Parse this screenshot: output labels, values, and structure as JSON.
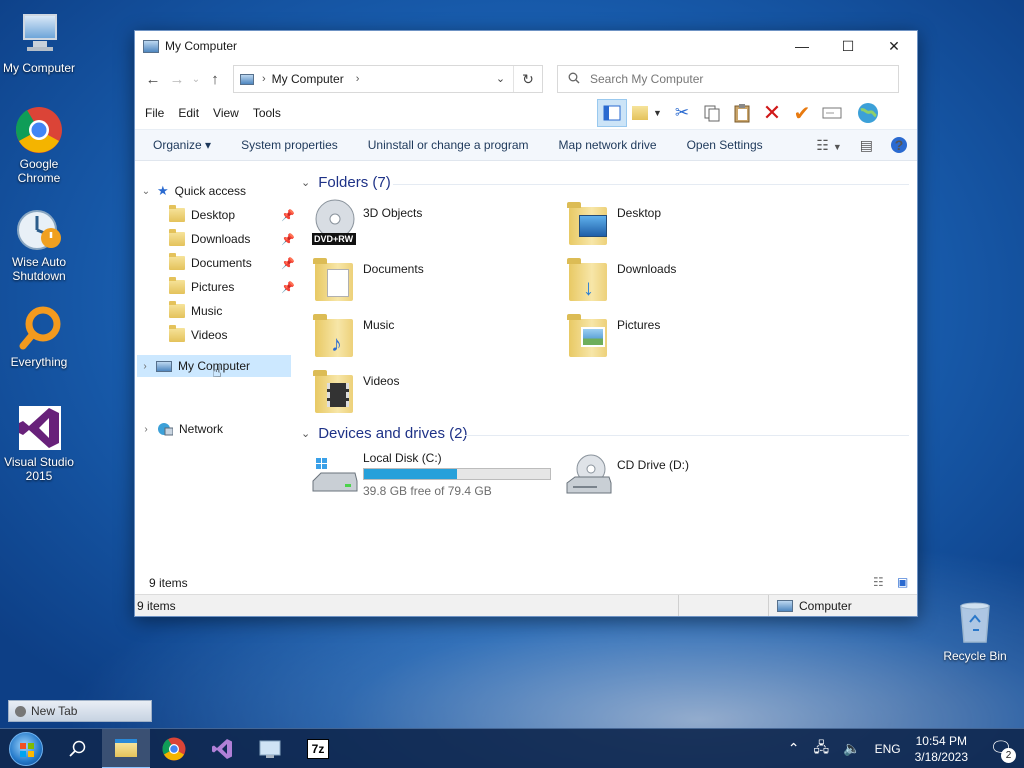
{
  "desktop": {
    "icons": [
      {
        "label": "My Computer",
        "icon": "computer-icon"
      },
      {
        "label": "Google Chrome",
        "icon": "chrome-icon"
      },
      {
        "label": "Wise Auto Shutdown",
        "icon": "wise-auto-shutdown-icon"
      },
      {
        "label": "Everything",
        "icon": "everything-icon"
      },
      {
        "label": "Visual Studio 2015",
        "icon": "visual-studio-icon"
      },
      {
        "label": "Recycle Bin",
        "icon": "recycle-bin-icon"
      }
    ]
  },
  "window": {
    "title": "My Computer",
    "controls": {
      "minimize": "—",
      "maximize": "☐",
      "close": "✕"
    },
    "address": {
      "location": "My Computer",
      "separator": "›"
    },
    "search": {
      "placeholder": "Search My Computer"
    },
    "menu": [
      "File",
      "Edit",
      "View",
      "Tools"
    ],
    "commands": [
      "Organize ▾",
      "System properties",
      "Uninstall or change a program",
      "Map network drive",
      "Open Settings"
    ],
    "help_label": "?",
    "nav": {
      "quick_access": "Quick access",
      "quick_items": [
        "Desktop",
        "Downloads",
        "Documents",
        "Pictures",
        "Music",
        "Videos"
      ],
      "my_computer": "My Computer",
      "network": "Network"
    },
    "folders_group": "Folders (7)",
    "folders": [
      {
        "label": "3D Objects",
        "badge": "DVD+RW"
      },
      {
        "label": "Desktop"
      },
      {
        "label": "Documents"
      },
      {
        "label": "Downloads"
      },
      {
        "label": "Music"
      },
      {
        "label": "Pictures"
      },
      {
        "label": "Videos"
      }
    ],
    "devices_group": "Devices and drives (2)",
    "drives": [
      {
        "label": "Local Disk (C:)",
        "free_text": "39.8 GB free of 79.4 GB",
        "used_fraction": 0.499
      },
      {
        "label": "CD Drive (D:)"
      }
    ],
    "inner_status": "9 items",
    "status": {
      "items": "9 items",
      "location": "Computer"
    }
  },
  "floating_tab": {
    "label": "New Tab"
  },
  "taskbar": {
    "apps": [
      "file-explorer-icon",
      "chrome-icon",
      "visual-studio-icon",
      "control-panel-icon",
      "7zip-icon"
    ],
    "lang": "ENG",
    "time": "10:54 PM",
    "date": "3/18/2023",
    "notifications": "2"
  },
  "colors": {
    "accent": "#26a0da",
    "selection": "#cce8ff",
    "group_header": "#1e3287"
  }
}
